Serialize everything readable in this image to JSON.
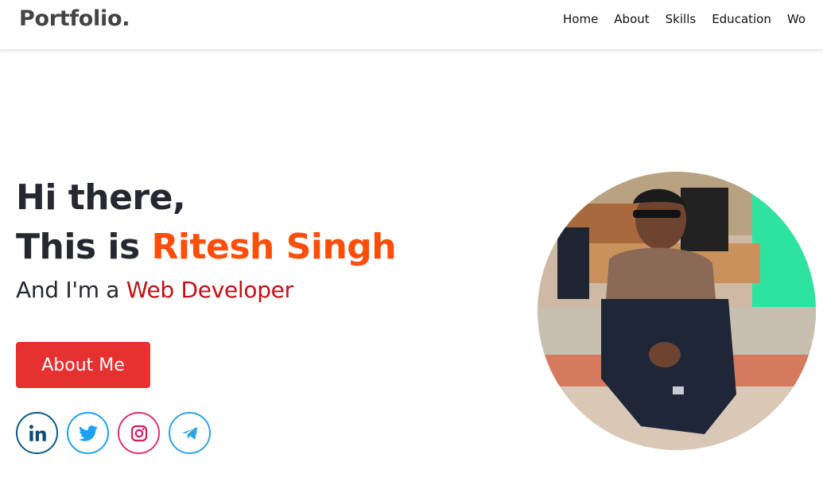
{
  "header": {
    "logo": "Portfolio.",
    "nav": [
      {
        "label": "Home"
      },
      {
        "label": "About"
      },
      {
        "label": "Skills"
      },
      {
        "label": "Education"
      },
      {
        "label": "Wo"
      }
    ]
  },
  "hero": {
    "line1": "Hi there,",
    "line2_prefix": "This is ",
    "name": "Ritesh Singh",
    "role_prefix": "And I'm a ",
    "role": "Web Developer",
    "cta_label": "About Me",
    "socials": [
      {
        "name": "linkedin-icon",
        "color": "#0a4e7c"
      },
      {
        "name": "twitter-icon",
        "color": "#1da1f2"
      },
      {
        "name": "instagram-icon",
        "color": "#d81b60"
      },
      {
        "name": "telegram-icon",
        "color": "#2ca5e0"
      }
    ]
  },
  "colors": {
    "accent_name": "#ff4d0a",
    "accent_role": "#c40f16",
    "button": "#e5312f",
    "heading": "#252830"
  }
}
